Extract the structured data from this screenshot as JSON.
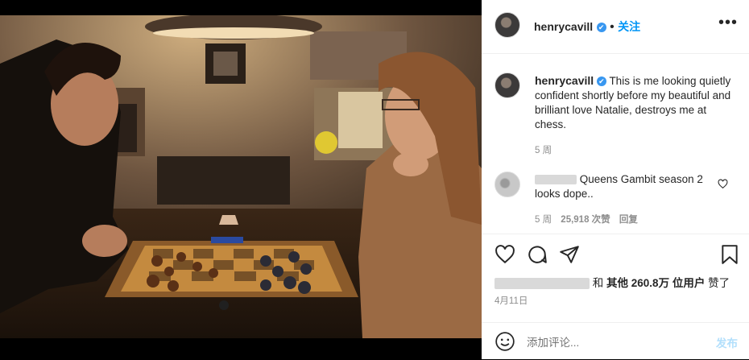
{
  "post": {
    "username": "henrycavill",
    "verified_mark": "✔",
    "follow_label": "关注",
    "more_label": "•••"
  },
  "caption": {
    "username": "henrycavill",
    "text": "This is me looking quietly confident shortly before my beautiful and brilliant love Natalie, destroys me at chess.",
    "age": "5 周"
  },
  "comment": {
    "text": "Queens Gambit season 2 looks dope..",
    "age": "5 周",
    "likes": "25,918 次赞",
    "reply_label": "回复"
  },
  "likes": {
    "connector": "和",
    "others": "其他 260.8万 位用户",
    "suffix": "赞了"
  },
  "date": "4月11日",
  "composer": {
    "placeholder": "添加评论...",
    "post_label": "发布"
  },
  "icons": {
    "like": "heart-icon",
    "comment": "speech-bubble-icon",
    "share": "paper-plane-icon",
    "save": "bookmark-icon",
    "emoji": "smiley-icon"
  },
  "colors": {
    "accent": "#0095f6",
    "muted": "#8e8e8e",
    "text": "#262626"
  }
}
